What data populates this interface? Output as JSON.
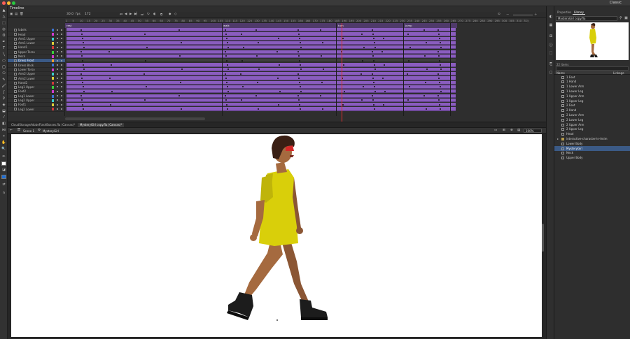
{
  "workspace": "Classic",
  "colors": {
    "layer_frames": "#8a5dbf",
    "selected": "#3b5a86",
    "playhead": "#e23030",
    "dress": "#d9cf0a",
    "skin": "#a56a3f",
    "hair": "#3a1f14",
    "boots": "#1c1c1c"
  },
  "timeline": {
    "panel_title": "Timeline",
    "fps": "30.0",
    "frame": "172",
    "ruler_ticks": [
      "1",
      "5",
      "10",
      "15",
      "20",
      "25",
      "30",
      "35",
      "40",
      "45",
      "50",
      "55",
      "60",
      "65",
      "70",
      "75",
      "80",
      "85",
      "90",
      "95",
      "100",
      "105",
      "110",
      "115",
      "120",
      "125",
      "130",
      "135",
      "140",
      "145",
      "150",
      "155",
      "160",
      "165",
      "170",
      "175",
      "180",
      "185",
      "190",
      "195",
      "200",
      "205",
      "210",
      "215",
      "220",
      "225",
      "230",
      "235",
      "240",
      "245",
      "250",
      "255",
      "260",
      "265",
      "270",
      "275",
      "280",
      "285",
      "290",
      "295",
      "300",
      "305",
      "310",
      "315"
    ],
    "frame_labels": [
      "rest",
      "walk",
      "turn",
      "jump"
    ],
    "layers": [
      {
        "name": "labels",
        "color": "#3b74d6"
      },
      {
        "name": "Head",
        "color": "#d23ad0"
      },
      {
        "name": "Arm1 Upper",
        "color": "#3ad0d0"
      },
      {
        "name": "Arm1 Lower",
        "color": "#e0d23a"
      },
      {
        "name": "Hand1",
        "color": "#d23a3a"
      },
      {
        "name": "Upper Torso",
        "color": "#3ad03a"
      },
      {
        "name": "Neck",
        "color": "#d23ad0"
      },
      {
        "name": "Dress Front",
        "color": "#ffa030"
      },
      {
        "name": "Dress Back",
        "color": "#3b74d6"
      },
      {
        "name": "Lower Torso",
        "color": "#d23ad0"
      },
      {
        "name": "Arm2 Upper",
        "color": "#3ad0d0"
      },
      {
        "name": "Arm2 Lower",
        "color": "#e0d23a"
      },
      {
        "name": "Hand2",
        "color": "#d23a3a"
      },
      {
        "name": "Leg1 Upper",
        "color": "#3ad03a"
      },
      {
        "name": "Foot2",
        "color": "#d23ad0"
      },
      {
        "name": "Leg1 Lower",
        "color": "#3b74d6"
      },
      {
        "name": "Leg2 Upper",
        "color": "#3ad0d0"
      },
      {
        "name": "Foot1",
        "color": "#e0d23a"
      },
      {
        "name": "Leg2 Lower",
        "color": "#d23a3a"
      }
    ],
    "selected_layer": "Dress Front"
  },
  "doc_tabs": [
    "CloudStorageAdobeFlashBosses.fla (Canvas)*",
    "MysteryGirl copy.fla (Canvas)*"
  ],
  "editbar": {
    "scene": "Scene 1",
    "symbol": "MysteryGirl",
    "zoom": "100%"
  },
  "library": {
    "tabs": [
      "Properties",
      "Library"
    ],
    "document": "MysteryGirl copy.fla",
    "count": "22 items",
    "col_name": "Name",
    "col_linkage": "Linkage",
    "items": [
      {
        "name": "1 Foot",
        "type": "graphic"
      },
      {
        "name": "1 Hand",
        "type": "graphic"
      },
      {
        "name": "1 Lower Arm",
        "type": "graphic"
      },
      {
        "name": "1 Lower Leg",
        "type": "graphic"
      },
      {
        "name": "1 Upper Arm",
        "type": "graphic"
      },
      {
        "name": "1 Upper Leg",
        "type": "graphic"
      },
      {
        "name": "2 Foot",
        "type": "graphic"
      },
      {
        "name": "2 Hand",
        "type": "graphic"
      },
      {
        "name": "2 Lower Arm",
        "type": "graphic"
      },
      {
        "name": "2 Lower Leg",
        "type": "graphic"
      },
      {
        "name": "2 Upper Arm",
        "type": "graphic"
      },
      {
        "name": "2 Upper Leg",
        "type": "graphic"
      },
      {
        "name": "Head",
        "type": "graphic"
      },
      {
        "name": "interactive-character-in-Anim",
        "type": "folder"
      },
      {
        "name": "Lower Body",
        "type": "graphic"
      },
      {
        "name": "MysteryGirl",
        "type": "movieclip"
      },
      {
        "name": "Neck",
        "type": "graphic"
      },
      {
        "name": "Upper Body",
        "type": "graphic"
      }
    ],
    "selected_item": "MysteryGirl"
  }
}
